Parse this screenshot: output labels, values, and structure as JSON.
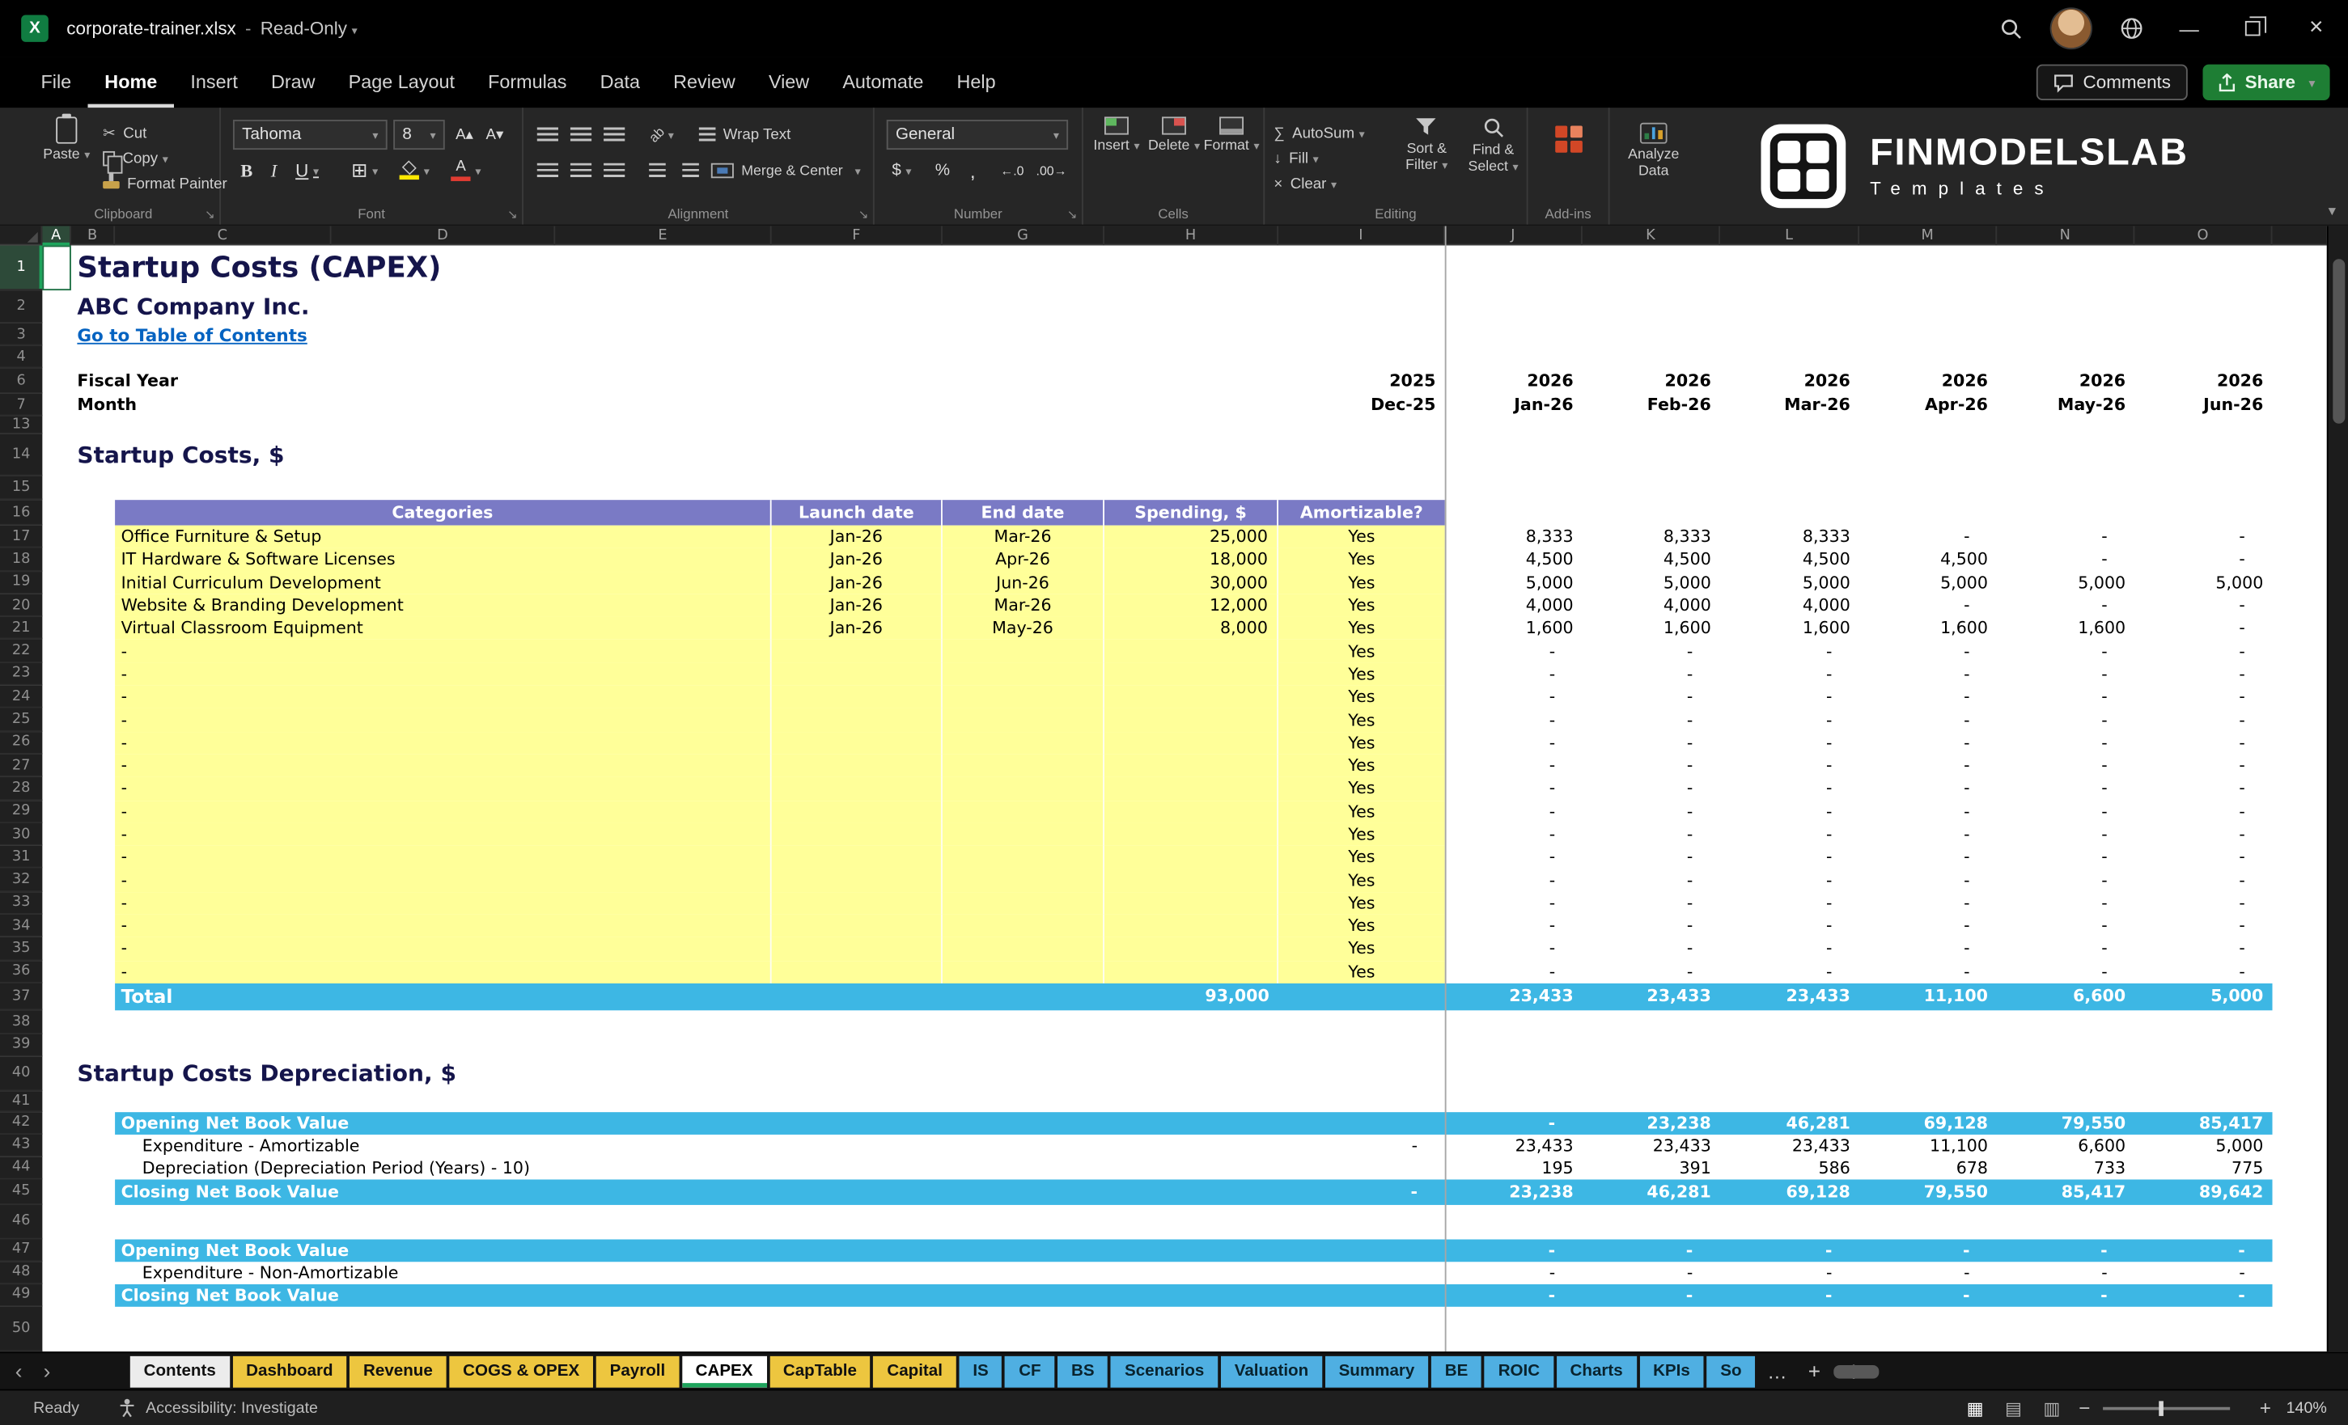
{
  "titlebar": {
    "app": "Excel",
    "filename": "corporate-trainer.xlsx",
    "mode": "Read-Only"
  },
  "menubar": {
    "items": [
      "File",
      "Home",
      "Insert",
      "Draw",
      "Page Layout",
      "Formulas",
      "Data",
      "Review",
      "View",
      "Automate",
      "Help"
    ],
    "active": "Home",
    "comments": "Comments",
    "share": "Share"
  },
  "icons": {
    "cut": "✂",
    "borders": "⊞",
    "currency": "$",
    "percent": "%",
    "comma_style": ",",
    "increase_decimal": "←.0",
    "decrease_decimal": ".00→",
    "autosum": "∑",
    "fill_down": "↓",
    "clear": "×",
    "grow_font": "A▴",
    "shrink_font": "A▾",
    "orientation": "ab",
    "prev_sheet": "‹",
    "next_sheet": "›",
    "minimize": "—",
    "close": "×",
    "collapse_ribbon": "▾"
  },
  "ribbon": {
    "clipboard": {
      "label": "Clipboard",
      "paste": "Paste",
      "cut": "Cut",
      "copy": "Copy",
      "format_painter": "Format Painter"
    },
    "font": {
      "label": "Font",
      "family": "Tahoma",
      "size": "8",
      "bold": "B",
      "italic": "I",
      "underline": "U"
    },
    "alignment": {
      "label": "Alignment",
      "wrap": "Wrap Text",
      "merge": "Merge & Center"
    },
    "number": {
      "label": "Number",
      "format": "General"
    },
    "cells": {
      "label": "Cells",
      "insert": "Insert",
      "delete": "Delete",
      "format": "Format"
    },
    "editing": {
      "label": "Editing",
      "autosum": "AutoSum",
      "fill": "Fill",
      "clear": "Clear",
      "sort_filter": "Sort & Filter",
      "find_select": "Find & Select"
    },
    "addins": {
      "label": "Add-ins",
      "analyze": "Analyze Data"
    },
    "brand": {
      "name": "FINMODELSLAB",
      "tagline": "Templates"
    }
  },
  "sheet": {
    "selected_column": "A",
    "selected_row": 1,
    "freeze_col": "J",
    "columns": [
      {
        "l": "A",
        "w": 19
      },
      {
        "l": "B",
        "w": 29
      },
      {
        "l": "C",
        "w": 143
      },
      {
        "l": "D",
        "w": 148
      },
      {
        "l": "E",
        "w": 143
      },
      {
        "l": "F",
        "w": 113
      },
      {
        "l": "G",
        "w": 107
      },
      {
        "l": "H",
        "w": 115
      },
      {
        "l": "I",
        "w": 110
      },
      {
        "l": "J",
        "w": 91
      },
      {
        "l": "K",
        "w": 91
      },
      {
        "l": "L",
        "w": 92
      },
      {
        "l": "M",
        "w": 91
      },
      {
        "l": "N",
        "w": 91
      },
      {
        "l": "O",
        "w": 91
      }
    ],
    "rows": [
      {
        "n": 1,
        "h": 30,
        "t": "text",
        "style": "title",
        "text": "Startup Costs (CAPEX)"
      },
      {
        "n": 2,
        "h": 22,
        "t": "text",
        "style": "company",
        "text": "ABC Company Inc."
      },
      {
        "n": 3,
        "h": 15,
        "t": "text",
        "style": "link",
        "text": "Go to Table of Contents"
      },
      {
        "n": 4,
        "h": 15,
        "t": "blank"
      },
      {
        "n": 6,
        "h": 17,
        "t": "periods",
        "label": "Fiscal Year",
        "vals": [
          "2025",
          "2026",
          "2026",
          "2026",
          "2026",
          "2026",
          "2026"
        ]
      },
      {
        "n": 7,
        "h": 15,
        "t": "periods",
        "label": "Month",
        "vals": [
          "Dec-25",
          "Jan-26",
          "Feb-26",
          "Mar-26",
          "Apr-26",
          "May-26",
          "Jun-26"
        ]
      },
      {
        "n": 13,
        "h": 12,
        "t": "blank"
      },
      {
        "n": 14,
        "h": 28,
        "t": "text",
        "style": "section",
        "text": "Startup Costs, $"
      },
      {
        "n": 15,
        "h": 16,
        "t": "blank"
      },
      {
        "n": 16,
        "h": 17,
        "t": "thead",
        "cells": [
          "Categories",
          "Launch date",
          "End date",
          "Spending, $",
          "Amortizable?"
        ]
      },
      {
        "n": 17,
        "h": 15.3,
        "t": "item",
        "cat": "Office Furniture & Setup",
        "launch": "Jan-26",
        "end": "Mar-26",
        "spend": "25,000",
        "amort": "Yes",
        "m": [
          "8,333",
          "8,333",
          "8,333",
          "-",
          "-",
          "-"
        ]
      },
      {
        "n": 18,
        "h": 15.3,
        "t": "item",
        "cat": "IT Hardware & Software Licenses",
        "launch": "Jan-26",
        "end": "Apr-26",
        "spend": "18,000",
        "amort": "Yes",
        "m": [
          "4,500",
          "4,500",
          "4,500",
          "4,500",
          "-",
          "-"
        ]
      },
      {
        "n": 19,
        "h": 15.3,
        "t": "item",
        "cat": "Initial Curriculum Development",
        "launch": "Jan-26",
        "end": "Jun-26",
        "spend": "30,000",
        "amort": "Yes",
        "m": [
          "5,000",
          "5,000",
          "5,000",
          "5,000",
          "5,000",
          "5,000"
        ]
      },
      {
        "n": 20,
        "h": 15.3,
        "t": "item",
        "cat": "Website & Branding Development",
        "launch": "Jan-26",
        "end": "Mar-26",
        "spend": "12,000",
        "amort": "Yes",
        "m": [
          "4,000",
          "4,000",
          "4,000",
          "-",
          "-",
          "-"
        ]
      },
      {
        "n": 21,
        "h": 15.3,
        "t": "item",
        "cat": "Virtual Classroom Equipment",
        "launch": "Jan-26",
        "end": "May-26",
        "spend": "8,000",
        "amort": "Yes",
        "m": [
          "1,600",
          "1,600",
          "1,600",
          "1,600",
          "1,600",
          "-"
        ]
      },
      {
        "n": 22,
        "h": 15.3,
        "t": "item",
        "cat": "-",
        "launch": "",
        "end": "",
        "spend": "",
        "amort": "Yes",
        "m": [
          "-",
          "-",
          "-",
          "-",
          "-",
          "-"
        ]
      },
      {
        "n": 23,
        "h": 15.3,
        "t": "item",
        "cat": "-",
        "launch": "",
        "end": "",
        "spend": "",
        "amort": "Yes",
        "m": [
          "-",
          "-",
          "-",
          "-",
          "-",
          "-"
        ]
      },
      {
        "n": 24,
        "h": 15.3,
        "t": "item",
        "cat": "-",
        "launch": "",
        "end": "",
        "spend": "",
        "amort": "Yes",
        "m": [
          "-",
          "-",
          "-",
          "-",
          "-",
          "-"
        ]
      },
      {
        "n": 25,
        "h": 15.3,
        "t": "item",
        "cat": "-",
        "launch": "",
        "end": "",
        "spend": "",
        "amort": "Yes",
        "m": [
          "-",
          "-",
          "-",
          "-",
          "-",
          "-"
        ]
      },
      {
        "n": 26,
        "h": 15.3,
        "t": "item",
        "cat": "-",
        "launch": "",
        "end": "",
        "spend": "",
        "amort": "Yes",
        "m": [
          "-",
          "-",
          "-",
          "-",
          "-",
          "-"
        ]
      },
      {
        "n": 27,
        "h": 15.3,
        "t": "item",
        "cat": "-",
        "launch": "",
        "end": "",
        "spend": "",
        "amort": "Yes",
        "m": [
          "-",
          "-",
          "-",
          "-",
          "-",
          "-"
        ]
      },
      {
        "n": 28,
        "h": 15.3,
        "t": "item",
        "cat": "-",
        "launch": "",
        "end": "",
        "spend": "",
        "amort": "Yes",
        "m": [
          "-",
          "-",
          "-",
          "-",
          "-",
          "-"
        ]
      },
      {
        "n": 29,
        "h": 15.3,
        "t": "item",
        "cat": "-",
        "launch": "",
        "end": "",
        "spend": "",
        "amort": "Yes",
        "m": [
          "-",
          "-",
          "-",
          "-",
          "-",
          "-"
        ]
      },
      {
        "n": 30,
        "h": 15.3,
        "t": "item",
        "cat": "-",
        "launch": "",
        "end": "",
        "spend": "",
        "amort": "Yes",
        "m": [
          "-",
          "-",
          "-",
          "-",
          "-",
          "-"
        ]
      },
      {
        "n": 31,
        "h": 15.3,
        "t": "item",
        "cat": "-",
        "launch": "",
        "end": "",
        "spend": "",
        "amort": "Yes",
        "m": [
          "-",
          "-",
          "-",
          "-",
          "-",
          "-"
        ]
      },
      {
        "n": 32,
        "h": 15.3,
        "t": "item",
        "cat": "-",
        "launch": "",
        "end": "",
        "spend": "",
        "amort": "Yes",
        "m": [
          "-",
          "-",
          "-",
          "-",
          "-",
          "-"
        ]
      },
      {
        "n": 33,
        "h": 15.3,
        "t": "item",
        "cat": "-",
        "launch": "",
        "end": "",
        "spend": "",
        "amort": "Yes",
        "m": [
          "-",
          "-",
          "-",
          "-",
          "-",
          "-"
        ]
      },
      {
        "n": 34,
        "h": 15.3,
        "t": "item",
        "cat": "-",
        "launch": "",
        "end": "",
        "spend": "",
        "amort": "Yes",
        "m": [
          "-",
          "-",
          "-",
          "-",
          "-",
          "-"
        ]
      },
      {
        "n": 35,
        "h": 15.3,
        "t": "item",
        "cat": "-",
        "launch": "",
        "end": "",
        "spend": "",
        "amort": "Yes",
        "m": [
          "-",
          "-",
          "-",
          "-",
          "-",
          "-"
        ]
      },
      {
        "n": 36,
        "h": 15.3,
        "t": "item",
        "cat": "-",
        "launch": "",
        "end": "",
        "spend": "",
        "amort": "Yes",
        "m": [
          "-",
          "-",
          "-",
          "-",
          "-",
          "-"
        ]
      },
      {
        "n": 37,
        "h": 18,
        "t": "total",
        "label": "Total",
        "spend": "93,000",
        "m": [
          "23,433",
          "23,433",
          "23,433",
          "11,100",
          "6,600",
          "5,000"
        ]
      },
      {
        "n": 38,
        "h": 16,
        "t": "blank"
      },
      {
        "n": 39,
        "h": 15,
        "t": "blank"
      },
      {
        "n": 40,
        "h": 23,
        "t": "text",
        "style": "section",
        "text": "Startup Costs Depreciation, $"
      },
      {
        "n": 41,
        "h": 14,
        "t": "blank"
      },
      {
        "n": 42,
        "h": 15,
        "t": "band",
        "label": "Opening Net Book Value",
        "i": "",
        "m": [
          "-",
          "23,238",
          "46,281",
          "69,128",
          "79,550",
          "85,417"
        ]
      },
      {
        "n": 43,
        "h": 15,
        "t": "drow",
        "label": "Expenditure - Amortizable",
        "i": "-",
        "m": [
          "23,433",
          "23,433",
          "23,433",
          "11,100",
          "6,600",
          "5,000"
        ]
      },
      {
        "n": 44,
        "h": 15,
        "t": "drow",
        "label": "Depreciation (Depreciation Period (Years) - 10)",
        "i": "",
        "m": [
          "195",
          "391",
          "586",
          "678",
          "733",
          "775"
        ]
      },
      {
        "n": 45,
        "h": 17,
        "t": "band",
        "label": "Closing Net Book Value",
        "i": "-",
        "m": [
          "23,238",
          "46,281",
          "69,128",
          "79,550",
          "85,417",
          "89,642"
        ]
      },
      {
        "n": 46,
        "h": 23,
        "t": "blank"
      },
      {
        "n": 47,
        "h": 15,
        "t": "band",
        "label": "Opening Net Book Value",
        "i": "",
        "m": [
          "-",
          "-",
          "-",
          "-",
          "-",
          "-"
        ]
      },
      {
        "n": 48,
        "h": 15,
        "t": "drow",
        "label": "Expenditure - Non-Amortizable",
        "i": "",
        "m": [
          "-",
          "-",
          "-",
          "-",
          "-",
          "-"
        ]
      },
      {
        "n": 49,
        "h": 15,
        "t": "band",
        "label": "Closing Net Book Value",
        "i": "",
        "m": [
          "-",
          "-",
          "-",
          "-",
          "-",
          "-"
        ]
      },
      {
        "n": 50,
        "h": 30,
        "t": "blank"
      }
    ]
  },
  "tabs": {
    "items": [
      {
        "label": "Contents",
        "c": "plain"
      },
      {
        "label": "Dashboard",
        "c": "yellow"
      },
      {
        "label": "Revenue",
        "c": "yellow"
      },
      {
        "label": "COGS & OPEX",
        "c": "yellow"
      },
      {
        "label": "Payroll",
        "c": "yellow"
      },
      {
        "label": "CAPEX",
        "c": "active"
      },
      {
        "label": "CapTable",
        "c": "yellow"
      },
      {
        "label": "Capital",
        "c": "yellow"
      },
      {
        "label": "IS",
        "c": "blue"
      },
      {
        "label": "CF",
        "c": "blue"
      },
      {
        "label": "BS",
        "c": "blue"
      },
      {
        "label": "Scenarios",
        "c": "blue"
      },
      {
        "label": "Valuation",
        "c": "blue"
      },
      {
        "label": "Summary",
        "c": "blue"
      },
      {
        "label": "BE",
        "c": "blue"
      },
      {
        "label": "ROIC",
        "c": "blue"
      },
      {
        "label": "Charts",
        "c": "blue"
      },
      {
        "label": "KPIs",
        "c": "blue"
      },
      {
        "label": "So",
        "c": "blue"
      }
    ],
    "more": "…",
    "add": "+",
    "menu": "⋮"
  },
  "statusbar": {
    "ready": "Ready",
    "accessibility": "Accessibility: Investigate",
    "zoom": "140%"
  },
  "colors": {
    "accent": "#1EA45C",
    "band_blue": "#3DB7E4",
    "table_yellow": "#FFFF99",
    "header_purple": "#7A7AC5",
    "link_blue": "#0563C1",
    "tab_yellow": "#EDC63F",
    "tab_blue": "#4FAFE2"
  }
}
